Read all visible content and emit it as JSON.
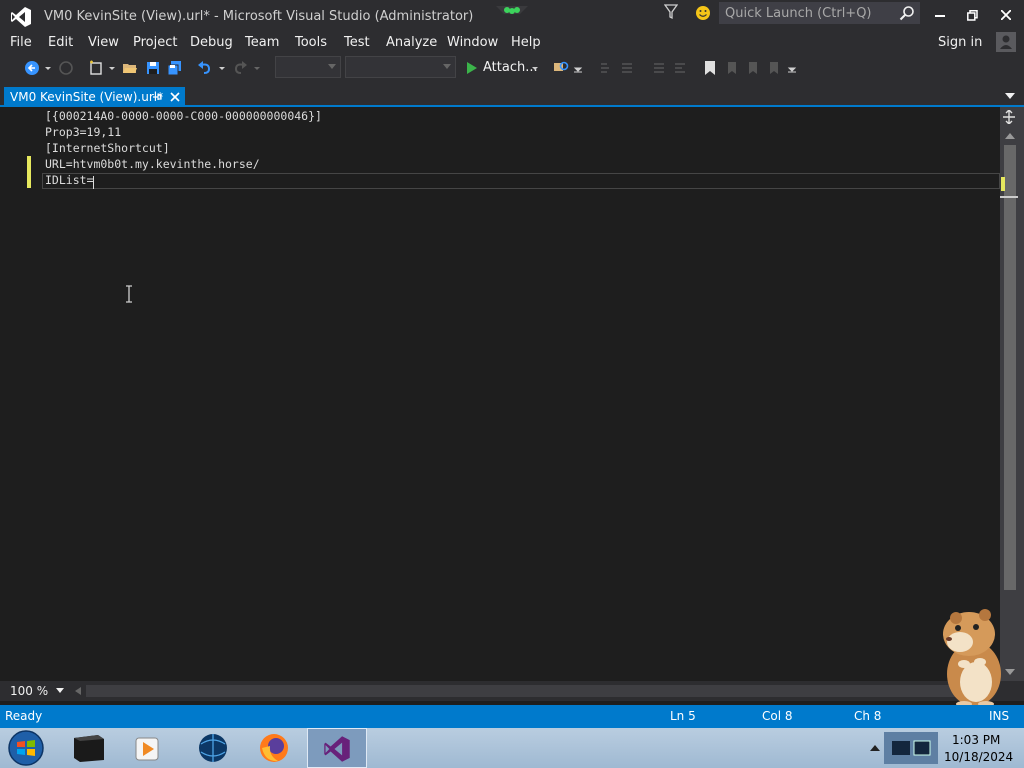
{
  "window": {
    "title": "VM0 KevinSite (View).url* - Microsoft Visual Studio (Administrator)",
    "quick_launch_placeholder": "Quick Launch (Ctrl+Q)"
  },
  "menu": {
    "items": [
      "File",
      "Edit",
      "View",
      "Project",
      "Debug",
      "Team",
      "Tools",
      "Test",
      "Analyze",
      "Window",
      "Help"
    ],
    "sign_in": "Sign in"
  },
  "toolbar": {
    "attach_label": "Attach..."
  },
  "tab": {
    "label": "VM0 KevinSite (View).url*"
  },
  "editor": {
    "lines": [
      "[{000214A0-0000-0000-C000-000000000046}]",
      "Prop3=19,11",
      "[InternetShortcut]",
      "URL=htvm0b0t.my.kevinthe.horse/",
      "IDList="
    ]
  },
  "zoom": {
    "level": "100 %"
  },
  "status": {
    "state": "Ready",
    "line": "Ln 5",
    "col": "Col 8",
    "ch": "Ch 8",
    "mode": "INS"
  },
  "taskbar": {
    "time": "1:03 PM",
    "date": "10/18/2024"
  },
  "colors": {
    "accent": "#007acc",
    "chrome": "#2d2d30",
    "editor_bg": "#1e1e1e",
    "change_marker": "#e6e85e",
    "vs_purple": "#68217a"
  }
}
